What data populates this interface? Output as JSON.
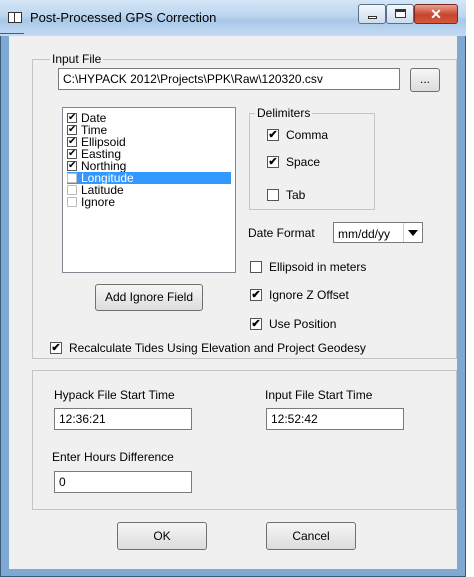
{
  "window": {
    "title": "Post-Processed GPS Correction"
  },
  "input_file": {
    "group_label": "Input File",
    "path": "C:\\HYPACK 2012\\Projects\\PPK\\Raw\\120320.csv",
    "browse_label": "..."
  },
  "fields_list": [
    {
      "label": "Date",
      "checked": true
    },
    {
      "label": "Time",
      "checked": true
    },
    {
      "label": "Ellipsoid",
      "checked": true
    },
    {
      "label": "Easting",
      "checked": true
    },
    {
      "label": "Northing",
      "checked": true
    },
    {
      "label": "Longitude",
      "checked": false,
      "selected": true
    },
    {
      "label": "Latitude",
      "checked": false
    },
    {
      "label": "Ignore",
      "checked": false
    }
  ],
  "add_ignore_label": "Add Ignore Field",
  "delimiters": {
    "group_label": "Delimiters",
    "comma": {
      "label": "Comma",
      "checked": true
    },
    "space": {
      "label": "Space",
      "checked": true
    },
    "tab": {
      "label": "Tab",
      "checked": false
    }
  },
  "date_format": {
    "label": "Date Format",
    "value": "mm/dd/yy"
  },
  "options": {
    "ellipsoid_meters": {
      "label": "Ellipsoid in meters",
      "checked": false
    },
    "ignore_z": {
      "label": "Ignore Z Offset",
      "checked": true
    },
    "use_position": {
      "label": "Use Position",
      "checked": true
    },
    "recalc_tides": {
      "label": "Recalculate Tides Using Elevation and Project Geodesy",
      "checked": true
    }
  },
  "times": {
    "hypack_label": "Hypack File Start Time",
    "hypack_value": "12:36:21",
    "input_label": "Input File Start Time",
    "input_value": "12:52:42",
    "hours_label": "Enter Hours Difference",
    "hours_value": "0"
  },
  "buttons": {
    "ok": "OK",
    "cancel": "Cancel"
  },
  "checkmark": "✔"
}
